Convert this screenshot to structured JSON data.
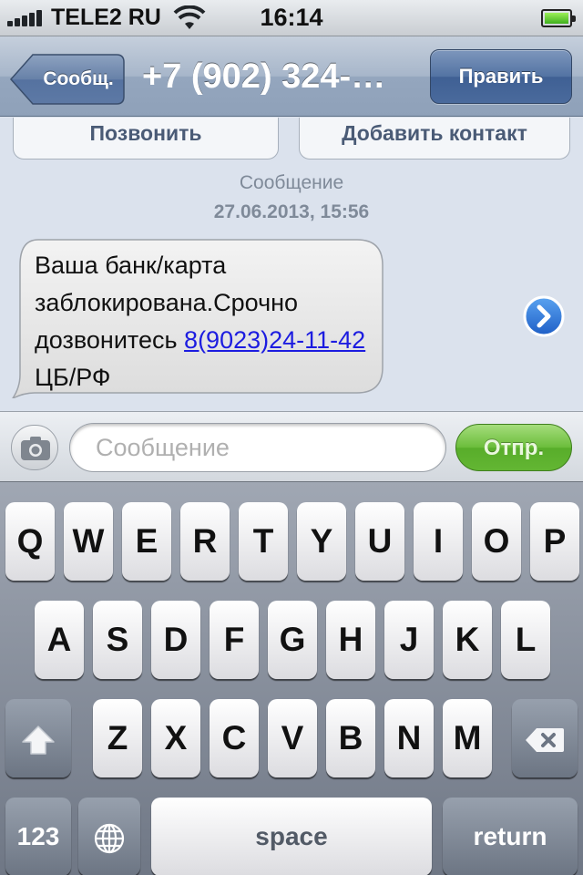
{
  "status_bar": {
    "carrier": "TELE2 RU",
    "time": "16:14",
    "signal_bars": 5,
    "battery_level": 1.0,
    "icons": [
      "signal-icon",
      "wifi-icon",
      "battery-icon"
    ]
  },
  "nav": {
    "back_label": "Сообщ.",
    "title": "+7 (902) 324-…",
    "edit_label": "Править"
  },
  "actions": {
    "call_label": "Позвонить",
    "add_contact_label": "Добавить контакт"
  },
  "thread": {
    "label": "Сообщение",
    "date": "27.06.2013, 15:56",
    "message": {
      "text_before_link": "Ваша банк/карта заблокирована.Срочно дозвонитесь ",
      "link": "8(9023)24-11-42",
      "text_after_link": " ЦБ/РФ",
      "icon": "disclosure-arrow-icon"
    }
  },
  "compose": {
    "placeholder": "Сообщение",
    "send_label": "Отпр.",
    "camera_icon": "camera-icon"
  },
  "keyboard": {
    "row1": [
      "Q",
      "W",
      "E",
      "R",
      "T",
      "Y",
      "U",
      "I",
      "O",
      "P"
    ],
    "row2": [
      "A",
      "S",
      "D",
      "F",
      "G",
      "H",
      "J",
      "K",
      "L"
    ],
    "row3": [
      "Z",
      "X",
      "C",
      "V",
      "B",
      "N",
      "M"
    ],
    "numbers_label": "123",
    "space_label": "space",
    "return_label": "return",
    "shift_icon": "shift-arrow-icon",
    "delete_icon": "backspace-icon",
    "globe_icon": "globe-icon"
  },
  "colors": {
    "nav_tint": "#8fa1b9",
    "send_green": "#63b633",
    "link_blue": "#1c1ce0"
  }
}
